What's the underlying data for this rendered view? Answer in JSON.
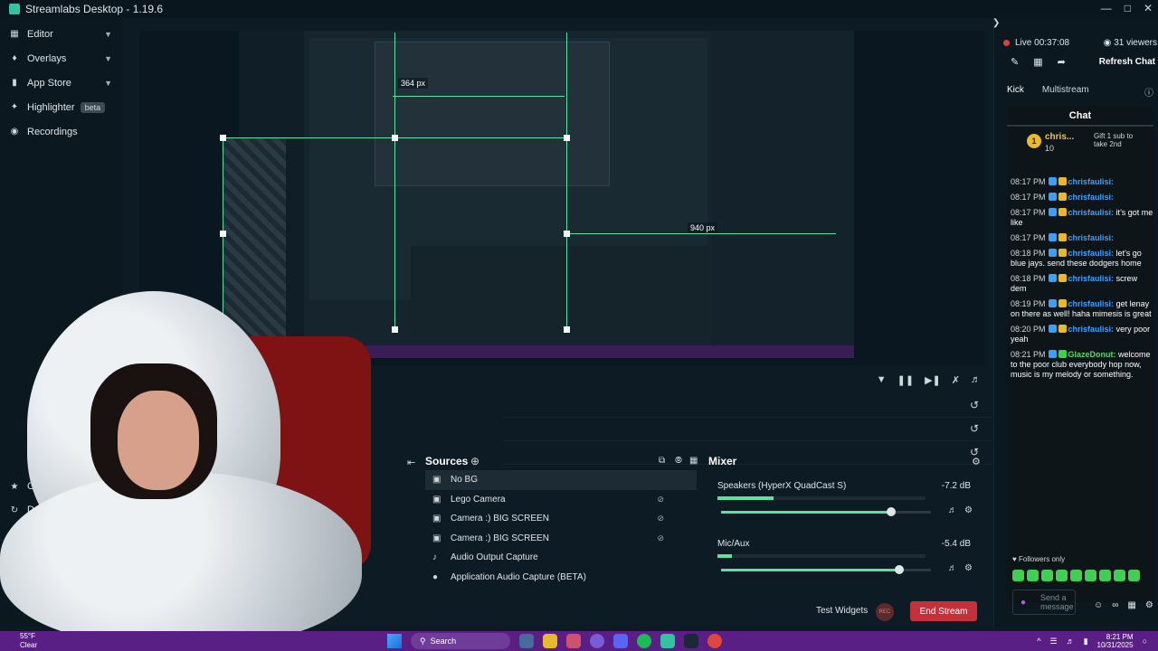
{
  "window": {
    "title": "Streamlabs Desktop - 1.19.6"
  },
  "sidebar": {
    "items": [
      {
        "label": "Editor",
        "icon": "editor-icon"
      },
      {
        "label": "Overlays",
        "icon": "overlays-icon"
      },
      {
        "label": "App Store",
        "icon": "app-store-icon"
      },
      {
        "label": "Highlighter",
        "badge": "beta",
        "icon": "highlighter-icon"
      },
      {
        "label": "Recordings",
        "icon": "recordings-icon"
      }
    ],
    "bottom": [
      {
        "label": "Get Ult"
      },
      {
        "label": "Da"
      },
      {
        "label": ""
      }
    ]
  },
  "preview": {
    "dimension_labels": [
      "364 px",
      "940 px"
    ]
  },
  "sources": {
    "title": "Sources",
    "items": [
      {
        "label": "No BG",
        "icon": "image-icon"
      },
      {
        "label": "Lego Camera",
        "icon": "camera-icon"
      },
      {
        "label": "Camera :) BIG SCREEN",
        "icon": "camera-icon"
      },
      {
        "label": "Camera :) BIG SCREEN",
        "icon": "camera-icon"
      },
      {
        "label": "Audio Output Capture",
        "icon": "speaker-icon"
      },
      {
        "label": "Application Audio Capture (BETA)",
        "icon": "person-icon"
      }
    ]
  },
  "mixer": {
    "title": "Mixer",
    "channels": [
      {
        "name": "Speakers (HyperX QuadCast S)",
        "db": "-7.2 dB",
        "level": 0.27,
        "volume": 0.81
      },
      {
        "name": "Mic/Aux",
        "db": "-5.4 dB",
        "level": 0.07,
        "volume": 0.85
      }
    ]
  },
  "footer": {
    "test_widgets": "Test Widgets",
    "rec_label": "REC",
    "end_stream": "End Stream"
  },
  "stream": {
    "live_label": "Live",
    "elapsed": "00:37:08",
    "viewers": "31 viewers",
    "refresh_chat": "Refresh Chat"
  },
  "chat": {
    "tabs": [
      "Kick",
      "Multistream"
    ],
    "title": "Chat",
    "pinned": {
      "rank": "1",
      "name": "chris...",
      "count": "10",
      "gift_text": "Gift 1 sub to take 2nd"
    },
    "messages": [
      {
        "time": "08:17 PM",
        "user": "chrisfaulisi:",
        "text": ""
      },
      {
        "time": "08:17 PM",
        "user": "chrisfaulisi:",
        "text": ""
      },
      {
        "time": "08:17 PM",
        "user": "chrisfaulisi:",
        "text": "it's got me like"
      },
      {
        "time": "08:17 PM",
        "user": "chrisfaulisi:",
        "text": ""
      },
      {
        "time": "08:18 PM",
        "user": "chrisfaulisi:",
        "text": "let's go blue jays. send these dodgers home"
      },
      {
        "time": "08:18 PM",
        "user": "chrisfaulisi:",
        "text": "screw dem"
      },
      {
        "time": "08:19 PM",
        "user": "chrisfaulisi:",
        "text": "get lenay on there as well! haha mimesis is great"
      },
      {
        "time": "08:20 PM",
        "user": "chrisfaulisi:",
        "text": "very poor yeah"
      },
      {
        "time": "08:21 PM",
        "user": "GlazeDonut:",
        "text": "welcome to the poor club everybody hop now, music is my melody or something."
      }
    ],
    "followers_only": "Followers only",
    "send_placeholder": "Send a message"
  },
  "taskbar": {
    "temp": "55°F",
    "condition": "Clear",
    "search": "Search",
    "time": "8:21 PM",
    "date": "10/31/2025"
  },
  "colors": {
    "accent": "#5ee0a0",
    "live": "#e53d3d",
    "end_stream": "#c6303a",
    "username": "#3aa0ff",
    "taskbar": "#5a1f85"
  }
}
